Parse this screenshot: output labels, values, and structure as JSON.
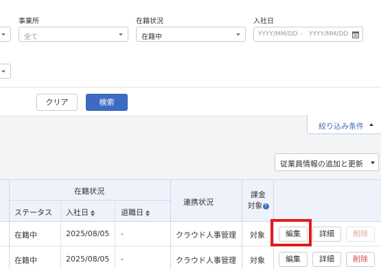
{
  "filters": {
    "office_label": "事業所",
    "office_value": "全て",
    "status_label": "在籍状況",
    "status_value": "在籍中",
    "hire_label": "入社日",
    "hire_from_placeholder": "YYYY/MM/DD",
    "hire_separator": "-",
    "hire_to_placeholder": "YYYY/MM/DD"
  },
  "actions": {
    "clear_label": "クリア",
    "search_label": "検索"
  },
  "panel": {
    "filter_conditions_label": "絞り込み条件"
  },
  "toolbar": {
    "add_update_label": "従業員情報の追加と更新"
  },
  "table": {
    "headers": {
      "employment_status": "在籍状況",
      "status": "ステータス",
      "hire_date": "入社日",
      "leave_date": "退職日",
      "link_status": "連携状況",
      "billing": "課金対象"
    },
    "rows": [
      {
        "status": "在籍中",
        "hire_date": "2025/08/05",
        "leave_date": "-",
        "link_status": "クラウド人事管理",
        "billing": "対象",
        "edit": "編集",
        "detail": "詳細",
        "delete": "削除"
      },
      {
        "status": "在籍中",
        "hire_date": "2025/08/05",
        "leave_date": "-",
        "link_status": "クラウド人事管理",
        "billing": "対象",
        "edit": "編集",
        "detail": "詳細",
        "delete": "削除"
      }
    ]
  },
  "colors": {
    "primary": "#3d6bc4",
    "highlight": "#e21a1a",
    "danger": "#d14a4a"
  }
}
